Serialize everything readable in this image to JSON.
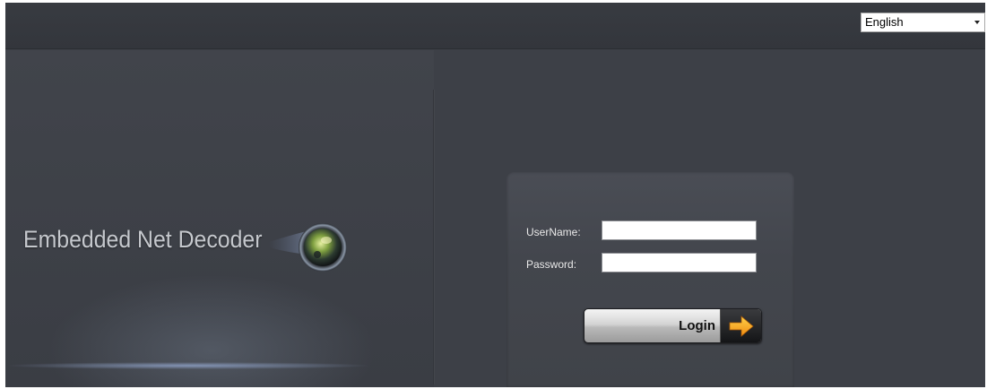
{
  "header": {
    "language_select": {
      "selected": "English",
      "icon": "dropdown-caret-icon"
    }
  },
  "branding": {
    "product_title": "Embedded Net Decoder",
    "logo_icon": "camera-lens-icon"
  },
  "login_form": {
    "username_label": "UserName:",
    "username_value": "",
    "password_label": "Password:",
    "password_value": "",
    "login_label": "Login",
    "login_icon": "arrow-right-icon"
  },
  "colors": {
    "background": "#3d4047",
    "top_bar": "#383b41",
    "login_panel": "#45484f",
    "arrow_accent": "#f5a21c"
  }
}
